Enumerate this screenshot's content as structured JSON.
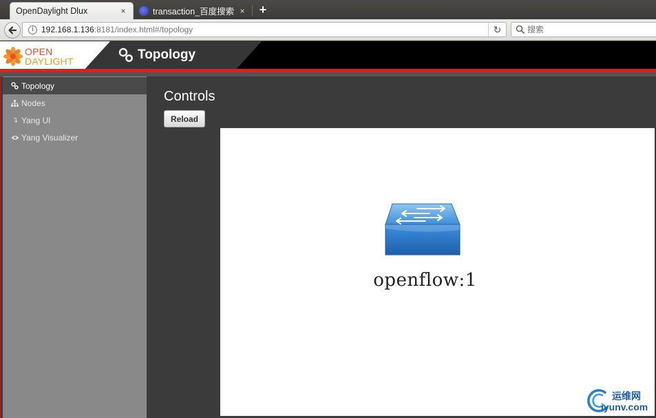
{
  "browser": {
    "tabs": [
      {
        "title": "OpenDaylight Dlux",
        "active": true
      },
      {
        "title": "transaction_百度搜索",
        "active": false
      }
    ],
    "new_tab_label": "+",
    "close_label": "×",
    "url": {
      "host": "192.168.1.136",
      "rest": ":8181/index.html#/topology"
    },
    "search_placeholder": "搜索"
  },
  "app": {
    "logo": {
      "line1": "OPEN",
      "line2": "DAYLIGHT"
    },
    "header_title": "Topology",
    "sidebar": {
      "items": [
        {
          "label": "Topology",
          "icon": "topology-icon",
          "active": true
        },
        {
          "label": "Nodes",
          "icon": "sitemap-icon",
          "active": false
        },
        {
          "label": "Yang UI",
          "icon": "arrow-return-icon",
          "active": false
        },
        {
          "label": "Yang Visualizer",
          "icon": "eye-icon",
          "active": false
        }
      ]
    },
    "main": {
      "title": "Controls",
      "reload_label": "Reload",
      "topology": {
        "nodes": [
          {
            "label": "openflow:1",
            "icon": "switch-icon"
          }
        ]
      }
    }
  },
  "watermark": {
    "line1": "运维网",
    "line2": "iyunv.com"
  },
  "colors": {
    "accent_red": "#d32420",
    "logo_red": "#e0502b",
    "logo_orange": "#f29a28",
    "switch_blue": "#2a7fd0"
  }
}
